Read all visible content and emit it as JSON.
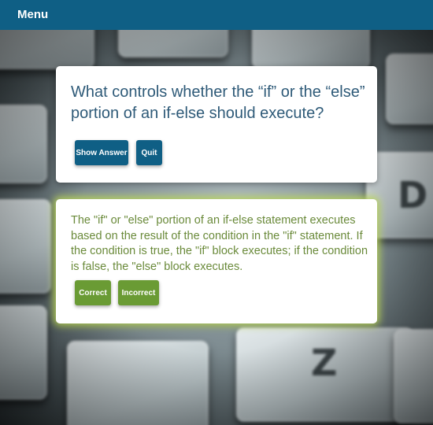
{
  "header": {
    "menu_label": "Menu"
  },
  "question_card": {
    "question": "What controls whether the “if” or the “else” portion of an if-else should execute?",
    "show_answer_label": "Show Answer",
    "quit_label": "Quit"
  },
  "answer_card": {
    "answer": "The \"if\" or \"else\" portion of an if-else statement executes based on the result of the condition in the \"if\" statement. If the condition is true, the \"if\" block executes; if the condition is false, the \"else\" block executes.",
    "correct_label": "Correct",
    "incorrect_label": "Incorrect"
  },
  "background": {
    "key_d": "D",
    "key_z": "Z"
  },
  "colors": {
    "header": "#0f5f85",
    "primary_button": "#0f5f85",
    "success_button": "#6a9b34",
    "question_text": "#2e5a78",
    "answer_text": "#6a8a3a"
  }
}
